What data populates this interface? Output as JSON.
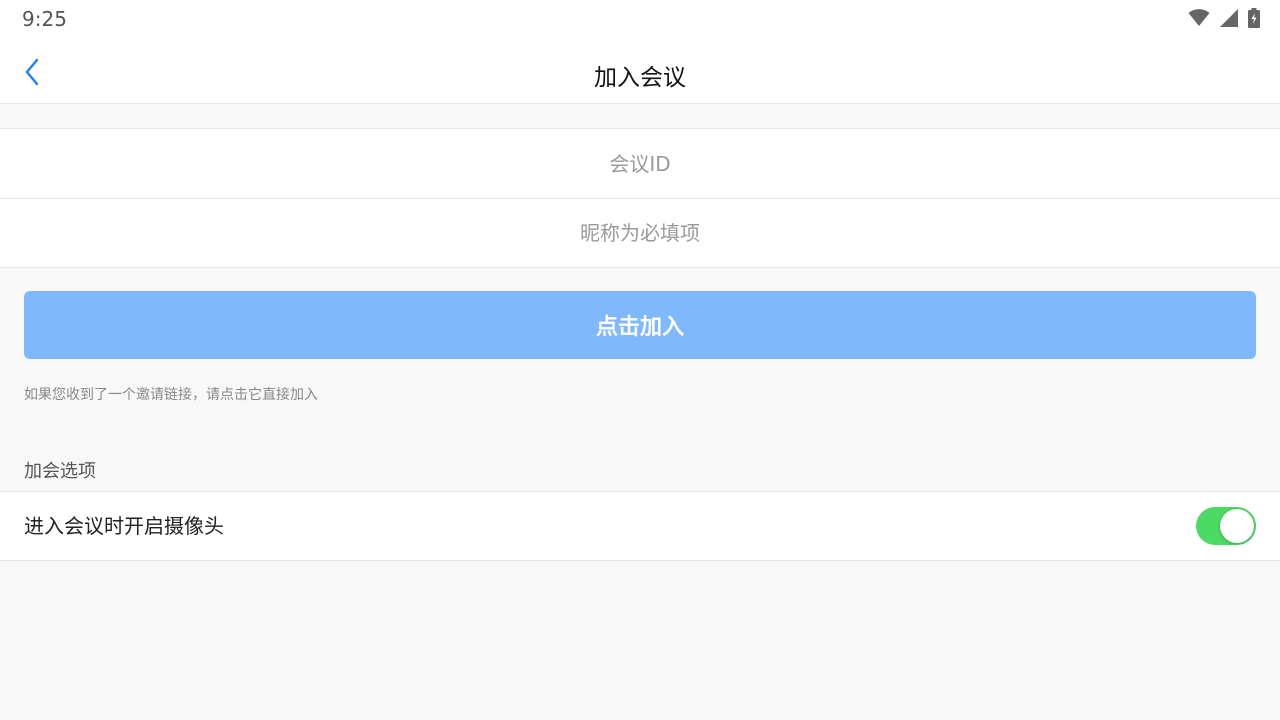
{
  "status_bar": {
    "time": "9:25",
    "icons": [
      "wifi-icon",
      "cellular-signal-icon",
      "battery-charging-icon"
    ]
  },
  "header": {
    "back_icon": "chevron-left-icon",
    "title": "加入会议"
  },
  "form": {
    "meeting_id": {
      "value": "",
      "placeholder": "会议ID"
    },
    "nickname": {
      "value": "",
      "placeholder": "昵称为必填项"
    }
  },
  "join_button": {
    "label": "点击加入"
  },
  "hint": "如果您收到了一个邀请链接，请点击它直接加入",
  "options": {
    "section_title": "加会选项",
    "camera_on_join": {
      "label": "进入会议时开启摄像头",
      "enabled": true
    }
  },
  "colors": {
    "accent": "#1e7ff0",
    "join_button_bg": "#80b8fd",
    "toggle_on": "#4cd964",
    "background": "#f8f8f8"
  }
}
